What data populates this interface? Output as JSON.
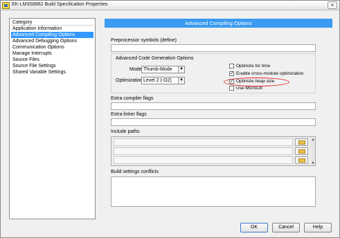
{
  "window": {
    "title": "EK-LM3S8962 Build Specification Properties",
    "close_glyph": "×"
  },
  "category": {
    "header": "Category",
    "items": [
      "Application Information",
      "Advanced Compiling Options",
      "Advanced Debugging Options",
      "Communication Options",
      "Manage Interrupts",
      "Source Files",
      "Source File Settings",
      "Shared Variable Settings"
    ],
    "selected_index": 1
  },
  "panel": {
    "title": "Advanced Compiling Options",
    "preprocessor_label": "Preprocessor symbols (define)",
    "preprocessor_value": "",
    "codegen_label": "Advanced Code Generation Options",
    "mode_label": "Mode",
    "mode_value": "Thumb-Mode",
    "optimization_label": "Optimization",
    "optimization_value": "Level 2 (-O2)",
    "checkboxes": [
      {
        "label": "Optimize for time",
        "checked": false
      },
      {
        "label": "Enable cross-module optimization",
        "checked": true
      },
      {
        "label": "Optimize heap size",
        "checked": true
      },
      {
        "label": "Use MicroLib",
        "checked": false
      }
    ],
    "extra_compiler_label": "Extra compiler flags",
    "extra_compiler_value": "",
    "extra_linker_label": "Extra linker flags",
    "extra_linker_value": "",
    "include_label": "Include paths",
    "conflicts_label": "Build settings conflicts",
    "conflicts_value": ""
  },
  "buttons": {
    "ok": "OK",
    "cancel": "Cancel",
    "help": "Help"
  },
  "colors": {
    "accent": "#3a9bf0",
    "selection": "#3399ff",
    "annotation": "#e02020"
  }
}
